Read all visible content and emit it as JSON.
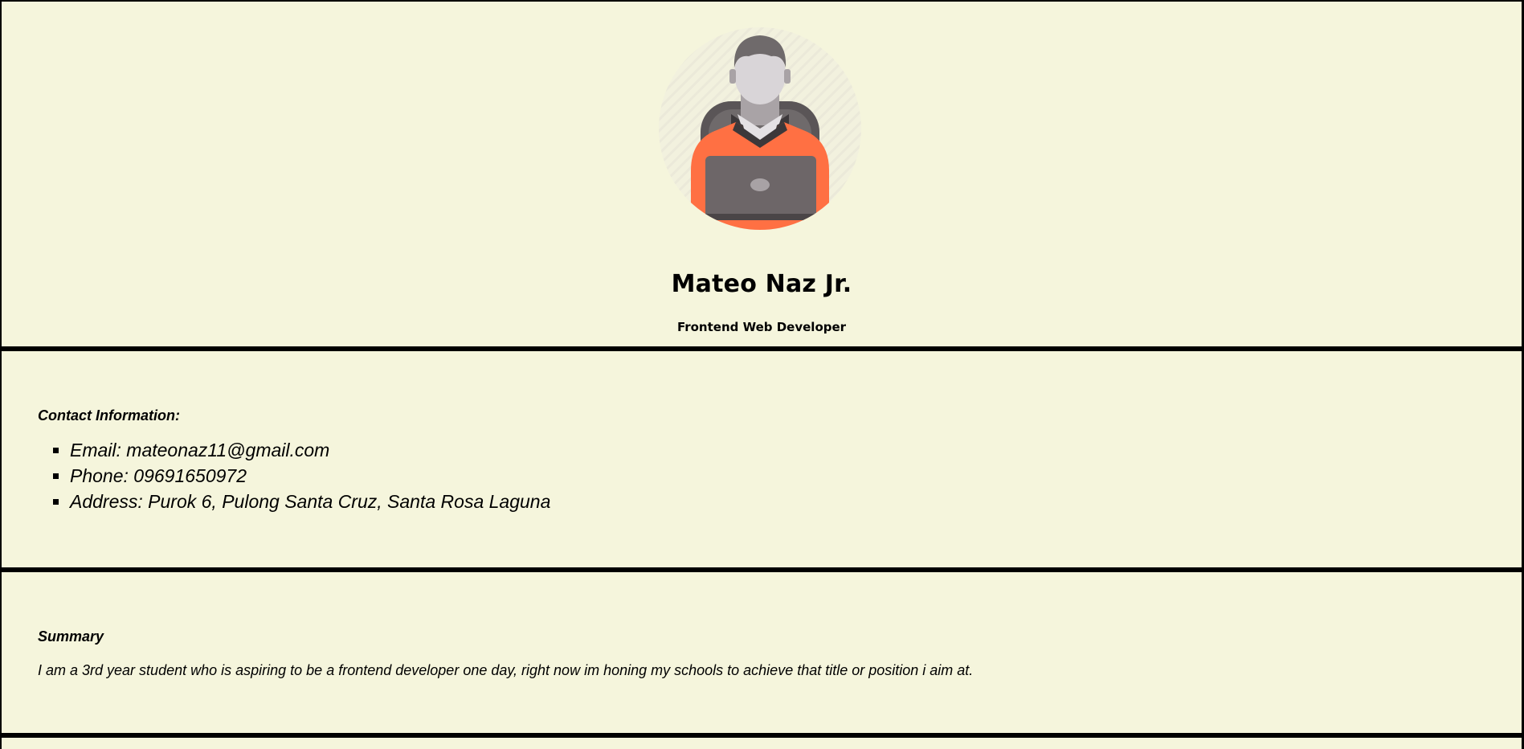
{
  "profile": {
    "name": "Mateo Naz Jr.",
    "role": "Frontend Web Developer",
    "avatar_icon": "developer-with-laptop-icon"
  },
  "contact": {
    "title": "Contact Information:",
    "items": [
      "Email: mateonaz11@gmail.com",
      "Phone: 09691650972",
      "Address: Purok 6, Pulong Santa Cruz, Santa Rosa Laguna"
    ]
  },
  "summary": {
    "title": "Summary",
    "text": "I am a 3rd year student who is aspiring to be a frontend developer one day, right now im honing my schools to achieve that title or position i aim at."
  },
  "colors": {
    "background": "#f5f5dc",
    "sweater": "#ff7043",
    "laptop": "#6d6668",
    "hair": "#6f6a6b",
    "skin": "#d9d5d8"
  }
}
